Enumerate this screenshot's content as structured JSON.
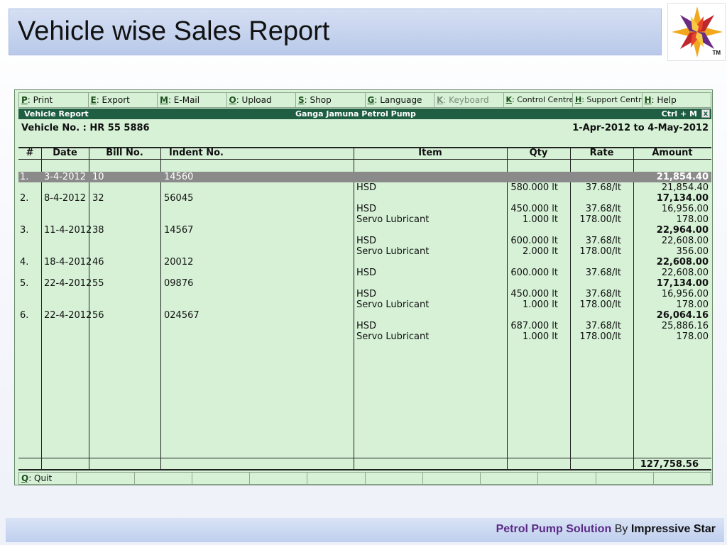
{
  "slide": {
    "title": "Vehicle wise Sales Report",
    "logo_tm": "TM",
    "footer": {
      "product": "Petrol Pump Solution",
      "by": "By",
      "company": "Impressive Star"
    }
  },
  "menu": [
    {
      "key": "P",
      "label": ": Print",
      "disabled": false
    },
    {
      "key": "E",
      "label": ": Export",
      "disabled": false
    },
    {
      "key": "M",
      "label": ": E-Mail",
      "disabled": false
    },
    {
      "key": "O",
      "label": ": Upload",
      "disabled": false
    },
    {
      "key": "S",
      "label": ": Shop",
      "disabled": false
    },
    {
      "key": "G",
      "label": ": Language",
      "disabled": false
    },
    {
      "key": "K",
      "label": ": Keyboard",
      "disabled": true
    },
    {
      "key": "K",
      "label": ": Control Centre",
      "disabled": false
    },
    {
      "key": "H",
      "label": ": Support Centre",
      "disabled": false
    },
    {
      "key": "H",
      "label": ": Help",
      "disabled": false
    }
  ],
  "window": {
    "title": "Vehicle Report",
    "company": "Ganga Jamuna Petrol Pump",
    "shortcut": "Ctrl + M",
    "close": "x"
  },
  "report": {
    "vehicle": "Vehicle No. : HR 55 5886",
    "period": "1-Apr-2012 to 4-May-2012",
    "columns": [
      "#",
      "Date",
      "Bill No.",
      "Indent No.",
      "Item",
      "Qty",
      "Rate",
      "Amount"
    ],
    "bills": [
      {
        "no": "1.",
        "date": "3-4-2012",
        "bill": "10",
        "indent": "14560",
        "total": "21,854.40",
        "items": [
          {
            "item": "HSD",
            "qty": "580.000 lt",
            "rate": "37.68/lt",
            "amount": "21,854.40"
          }
        ]
      },
      {
        "no": "2.",
        "date": "8-4-2012",
        "bill": "32",
        "indent": "56045",
        "total": "17,134.00",
        "items": [
          {
            "item": "HSD",
            "qty": "450.000 lt",
            "rate": "37.68/lt",
            "amount": "16,956.00"
          },
          {
            "item": "Servo Lubricant",
            "qty": "1.000 lt",
            "rate": "178.00/lt",
            "amount": "178.00"
          }
        ]
      },
      {
        "no": "3.",
        "date": "11-4-2012",
        "bill": "38",
        "indent": "14567",
        "total": "22,964.00",
        "items": [
          {
            "item": "HSD",
            "qty": "600.000 lt",
            "rate": "37.68/lt",
            "amount": "22,608.00"
          },
          {
            "item": "Servo Lubricant",
            "qty": "2.000 lt",
            "rate": "178.00/lt",
            "amount": "356.00"
          }
        ]
      },
      {
        "no": "4.",
        "date": "18-4-2012",
        "bill": "46",
        "indent": "20012",
        "total": "22,608.00",
        "items": [
          {
            "item": "HSD",
            "qty": "600.000 lt",
            "rate": "37.68/lt",
            "amount": "22,608.00"
          }
        ]
      },
      {
        "no": "5.",
        "date": "22-4-2012",
        "bill": "55",
        "indent": "09876",
        "total": "17,134.00",
        "items": [
          {
            "item": "HSD",
            "qty": "450.000 lt",
            "rate": "37.68/lt",
            "amount": "16,956.00"
          },
          {
            "item": "Servo Lubricant",
            "qty": "1.000 lt",
            "rate": "178.00/lt",
            "amount": "178.00"
          }
        ]
      },
      {
        "no": "6.",
        "date": "22-4-2012",
        "bill": "56",
        "indent": "024567",
        "total": "26,064.16",
        "items": [
          {
            "item": "HSD",
            "qty": "687.000 lt",
            "rate": "37.68/lt",
            "amount": "25,886.16"
          },
          {
            "item": "Servo Lubricant",
            "qty": "1.000 lt",
            "rate": "178.00/lt",
            "amount": "178.00"
          }
        ]
      }
    ],
    "grand_total": "127,758.56"
  },
  "footer_buttons": [
    {
      "key": "Q",
      "label": ": Quit"
    }
  ],
  "colors": {
    "window_bg": "#d6f1d6",
    "titlebar": "#1f5e43",
    "selected_row": "#8a8a8a",
    "footer_brand": "#5b2a86"
  }
}
